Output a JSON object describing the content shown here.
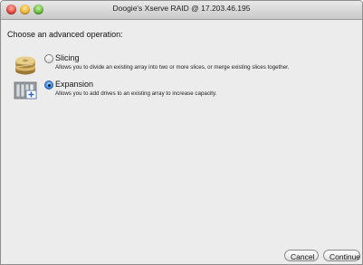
{
  "window": {
    "title": "Doogie's Xserve RAID @ 17.203.46.195"
  },
  "heading": "Choose an advanced operation:",
  "options": [
    {
      "name": "Slicing",
      "description": "Allows you to divide an existing array into two or more slices, or merge existing slices together.",
      "selected": false,
      "icon": "disk-slices-icon"
    },
    {
      "name": "Expansion",
      "description": "Allows you to add drives to an existing array to increase capacity.",
      "selected": true,
      "icon": "drive-expansion-icon"
    }
  ],
  "buttons": {
    "cancel": "Cancel",
    "continue": "Continue"
  }
}
